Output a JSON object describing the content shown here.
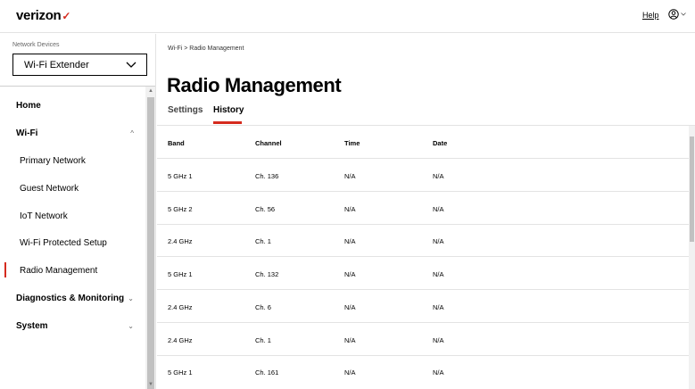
{
  "header": {
    "logo_text": "verizon",
    "logo_mark": "✓",
    "help_label": "Help",
    "account_chevron": "⌄"
  },
  "sidebar": {
    "network_devices_label": "Network Devices",
    "device_selected": "Wi-Fi Extender",
    "nav": {
      "home": "Home",
      "wifi": "Wi-Fi",
      "wifi_caret": "^",
      "primary_network": "Primary Network",
      "guest_network": "Guest Network",
      "iot_network": "IoT Network",
      "wps": "Wi-Fi Protected Setup",
      "radio_management": "Radio Management",
      "diagnostics": "Diagnostics & Monitoring",
      "diagnostics_caret": "⌄",
      "system": "System",
      "system_caret": "⌄"
    }
  },
  "main": {
    "breadcrumb": "Wi-Fi  >  Radio Management",
    "title": "Radio Management",
    "tabs": {
      "settings": "Settings",
      "history": "History"
    },
    "table": {
      "headers": [
        "Band",
        "Channel",
        "Time",
        "Date"
      ],
      "rows": [
        [
          "5 GHz 1",
          "Ch. 136",
          "N/A",
          "N/A"
        ],
        [
          "5 GHz 2",
          "Ch. 56",
          "N/A",
          "N/A"
        ],
        [
          "2.4 GHz",
          "Ch. 1",
          "N/A",
          "N/A"
        ],
        [
          "5 GHz 1",
          "Ch. 132",
          "N/A",
          "N/A"
        ],
        [
          "2.4 GHz",
          "Ch. 6",
          "N/A",
          "N/A"
        ],
        [
          "2.4 GHz",
          "Ch. 1",
          "N/A",
          "N/A"
        ],
        [
          "5 GHz 1",
          "Ch. 161",
          "N/A",
          "N/A"
        ]
      ]
    }
  },
  "colors": {
    "accent": "#d52b1e",
    "divider": "#e3e3e3"
  }
}
